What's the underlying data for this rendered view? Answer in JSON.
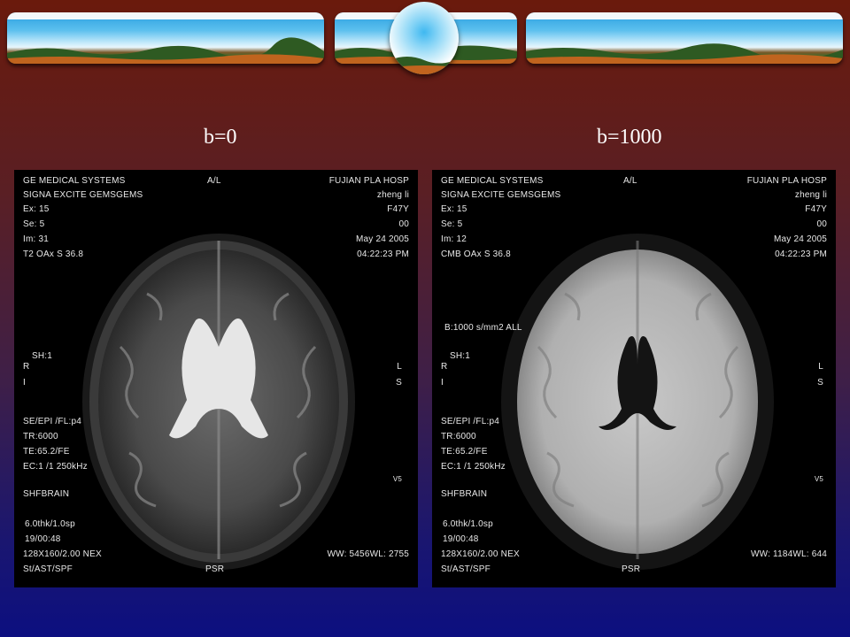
{
  "labels": {
    "left": "b=0",
    "right": "b=1000"
  },
  "left_scan": {
    "tl": [
      "GE MEDICAL SYSTEMS",
      "SIGNA EXCITE GEMSGEMS",
      "Ex: 15",
      "Se: 5",
      "Im: 31",
      "T2 OAx  S 36.8"
    ],
    "top_center": "A/L",
    "tr": [
      "FUJIAN PLA HOSP",
      "zheng li",
      "F47Y",
      "00",
      "May 24 2005",
      "04:22:23 PM"
    ],
    "mid_left": [
      "SH:1",
      "R",
      "I"
    ],
    "mid_right": [
      "L",
      "S"
    ],
    "bl": [
      "SE/EPI    /FL:p4",
      "TR:6000",
      "TE:65.2/FE",
      "EC:1 /1  250kHz",
      "",
      "SHFBRAIN",
      "",
      "6.0thk/1.0sp",
      "19/00:48",
      "128X160/2.00 NEX",
      "St/AST/SPF"
    ],
    "br_small": "V5",
    "bottom_center": "PSR",
    "ww": "WW: 5456WL: 2755"
  },
  "right_scan": {
    "tl": [
      "GE MEDICAL SYSTEMS",
      "SIGNA EXCITE GEMSGEMS",
      "Ex: 15",
      "Se: 5",
      "Im: 12",
      "CMB OAx  S 36.8"
    ],
    "top_center": "A/L",
    "tr": [
      "FUJIAN PLA HOSP",
      "zheng li",
      "F47Y",
      "00",
      "May 24 2005",
      "04:22:23 PM"
    ],
    "b_value": "B:1000 s/mm2 ALL",
    "mid_left": [
      "SH:1",
      "R",
      "I"
    ],
    "mid_right": [
      "L",
      "S"
    ],
    "bl": [
      "SE/EPI    /FL:p4",
      "TR:6000",
      "TE:65.2/FE",
      "EC:1 /1  250kHz",
      "",
      "SHFBRAIN",
      "",
      "6.0thk/1.0sp",
      "19/00:48",
      "128X160/2.00 NEX",
      "St/AST/SPF"
    ],
    "br_small": "V5",
    "bottom_center": "PSR",
    "ww": "WW: 1184WL: 644"
  },
  "colors": {
    "text": "#ffffff",
    "scan_text": "#e8e8e8"
  }
}
